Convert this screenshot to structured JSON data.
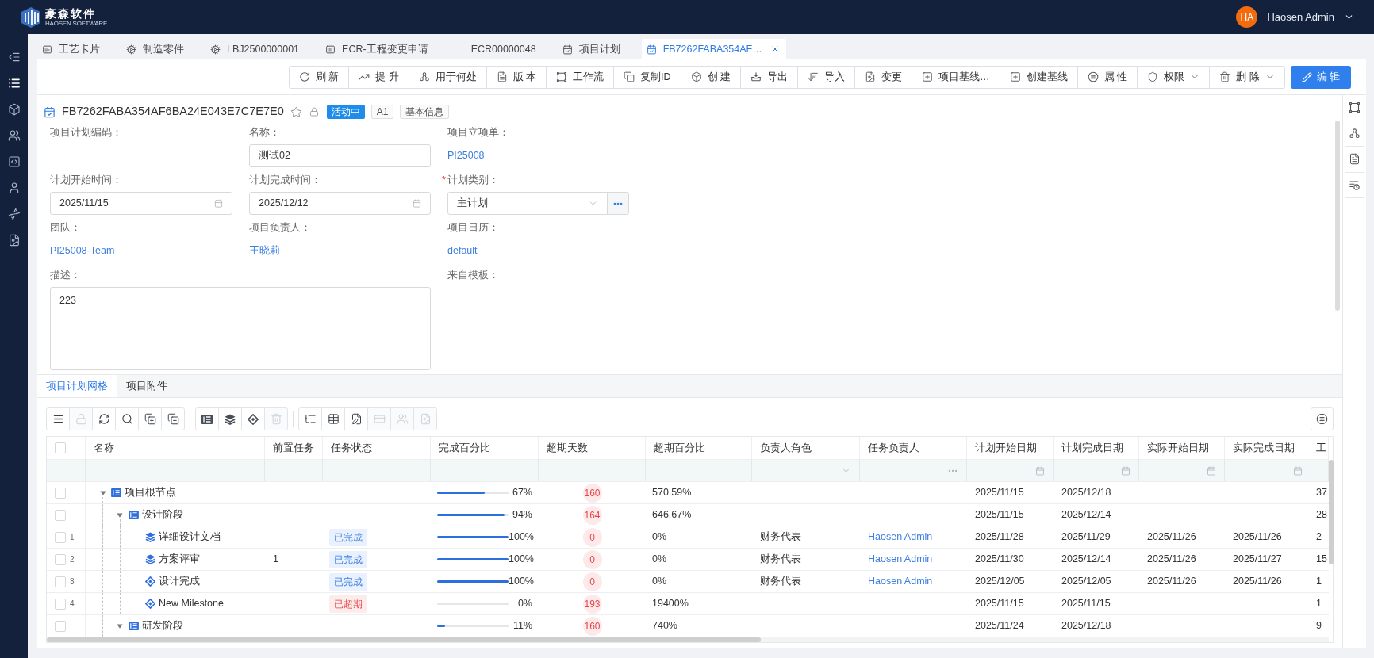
{
  "header": {
    "logo": {
      "name": "豪森软件",
      "tagline": "HAOSEN SOFTWARE"
    },
    "user": {
      "initials": "HA",
      "name": "Haosen Admin"
    }
  },
  "sidebar": {
    "items": [
      {
        "kind": "collapse",
        "selected": false
      },
      {
        "kind": "list",
        "selected": true
      },
      {
        "kind": "cube",
        "selected": false
      },
      {
        "kind": "team",
        "selected": false
      },
      {
        "kind": "code",
        "selected": false
      },
      {
        "kind": "user",
        "selected": false
      },
      {
        "kind": "dna",
        "selected": false
      },
      {
        "kind": "cad",
        "selected": false
      }
    ]
  },
  "tabs": [
    {
      "kind": "card",
      "label": "工艺卡片",
      "selected": false,
      "closable": false
    },
    {
      "kind": "part",
      "label": "制造零件",
      "selected": false,
      "closable": false
    },
    {
      "kind": "part",
      "label": "LBJ2500000001",
      "selected": false,
      "closable": false
    },
    {
      "kind": "ecr",
      "label": "ECR-工程变更申请",
      "selected": false,
      "closable": false
    },
    {
      "kind": "plain",
      "label": "ECR00000048",
      "selected": false,
      "closable": false
    },
    {
      "kind": "plan",
      "label": "项目计划",
      "selected": false,
      "closable": false
    },
    {
      "kind": "plan",
      "label": "FB7262FABA354AF…",
      "selected": true,
      "closable": true
    }
  ],
  "toolbar": {
    "buttons": [
      {
        "kind": "refresh",
        "label": "刷 新",
        "dropdown": false
      },
      {
        "kind": "promote",
        "label": "提 升",
        "dropdown": false
      },
      {
        "kind": "where_used",
        "label": "用于何处",
        "dropdown": false
      },
      {
        "kind": "version",
        "label": "版 本",
        "dropdown": false
      },
      {
        "kind": "workflow",
        "label": "工作流",
        "dropdown": false
      },
      {
        "kind": "copy",
        "label": "复制ID",
        "dropdown": false
      },
      {
        "kind": "create",
        "label": "创 建",
        "dropdown": false
      },
      {
        "kind": "export",
        "label": "导出",
        "dropdown": false
      },
      {
        "kind": "import",
        "label": "导入",
        "dropdown": false
      },
      {
        "kind": "change",
        "label": "变更",
        "dropdown": false
      },
      {
        "kind": "baseline",
        "label": "项目基线…",
        "dropdown": false
      },
      {
        "kind": "baseline",
        "label": "创建基线",
        "dropdown": false
      },
      {
        "kind": "properties",
        "label": "属 性",
        "dropdown": false
      },
      {
        "kind": "permission",
        "label": "权限",
        "dropdown": true
      },
      {
        "kind": "delete",
        "label": "删 除",
        "dropdown": true
      }
    ],
    "edit_button": {
      "label": "编 辑"
    }
  },
  "record": {
    "id": "FB7262FABA354AF6BA24E043E7C7E7E0",
    "starred": false,
    "status": "活动中",
    "revision": "A1",
    "info": "基本信息"
  },
  "form": {
    "fields": [
      {
        "kind": "text",
        "label": "项目计划编码："
      },
      {
        "kind": "input",
        "label": "名称：",
        "value": "测试02"
      },
      {
        "kind": "link",
        "label": "项目立项单：",
        "value": "PI25008"
      },
      {
        "kind": "date",
        "label": "计划开始时间：",
        "value": "2025/11/15"
      },
      {
        "kind": "date",
        "label": "计划完成时间：",
        "value": "2025/12/12"
      },
      {
        "kind": "select",
        "label": "计划类别：",
        "required_mark": "*",
        "value": "主计划"
      },
      {
        "kind": "link",
        "label": "团队：",
        "value": "PI25008-Team"
      },
      {
        "kind": "link",
        "label": "项目负责人：",
        "value": "王晓莉"
      },
      {
        "kind": "link",
        "label": "项目日历：",
        "value": "default"
      },
      {
        "kind": "textarea",
        "label": "描述：",
        "value": "223"
      },
      {
        "kind": "text",
        "label": "来自模板："
      }
    ]
  },
  "grid": {
    "tabs": [
      {
        "label": "项目计划网格",
        "selected": true
      },
      {
        "label": "项目附件",
        "selected": false
      }
    ],
    "toolbar_groups": [
      {
        "buttons": [
          {
            "kind": "menu",
            "disabled": false
          },
          {
            "kind": "lock",
            "disabled": true
          },
          {
            "kind": "reload",
            "disabled": false
          },
          {
            "kind": "search",
            "disabled": false
          },
          {
            "kind": "expand",
            "disabled": false
          },
          {
            "kind": "collapse",
            "disabled": false
          }
        ]
      },
      {
        "buttons": [
          {
            "kind": "phase",
            "disabled": false
          },
          {
            "kind": "task",
            "disabled": false
          },
          {
            "kind": "milestone",
            "disabled": false
          },
          {
            "kind": "delete",
            "disabled": true
          }
        ]
      },
      {
        "buttons": [
          {
            "kind": "tree",
            "disabled": false
          },
          {
            "kind": "table",
            "disabled": false
          },
          {
            "kind": "edit",
            "disabled": false
          },
          {
            "kind": "card",
            "disabled": true
          },
          {
            "kind": "people",
            "disabled": true
          },
          {
            "kind": "image",
            "disabled": true
          }
        ]
      }
    ],
    "table": {
      "select_all_checked": false,
      "columns": [
        {
          "label": "名称",
          "kind": "plain"
        },
        {
          "label": "前置任务",
          "kind": "plain"
        },
        {
          "label": "任务状态",
          "kind": "plain"
        },
        {
          "label": "完成百分比",
          "kind": "plain"
        },
        {
          "label": "超期天数",
          "kind": "plain"
        },
        {
          "label": "超期百分比",
          "kind": "plain"
        },
        {
          "label": "负责人角色",
          "kind": "select"
        },
        {
          "label": "任务负责人",
          "kind": "lookup"
        },
        {
          "label": "计划开始日期",
          "kind": "date"
        },
        {
          "label": "计划完成日期",
          "kind": "date"
        },
        {
          "label": "实际开始日期",
          "kind": "date"
        },
        {
          "label": "实际完成日期",
          "kind": "date"
        },
        {
          "label": "工",
          "kind": "plain"
        }
      ],
      "rows": [
        {
          "name": "项目根节点",
          "kind": "phase",
          "expanded": true,
          "checked": false,
          "progress": {
            "level": 0.67,
            "reading": "67%"
          },
          "overdue_days": "160",
          "overdue_pct": "570.59%",
          "plan_start": "2025/11/15",
          "plan_end": "2025/12/18",
          "column_13": "37",
          "children": [
            {
              "name": "设计阶段",
              "kind": "phase",
              "expanded": true,
              "checked": false,
              "progress": {
                "level": 0.94,
                "reading": "94%"
              },
              "overdue_days": "164",
              "overdue_pct": "646.67%",
              "plan_start": "2025/11/15",
              "plan_end": "2025/12/14",
              "column_13": "28",
              "children": [
                {
                  "index": "1",
                  "name": "详细设计文档",
                  "kind": "task",
                  "checked": false,
                  "status": {
                    "label": "已完成",
                    "kind": "done"
                  },
                  "progress": {
                    "level": 1,
                    "reading": "100%"
                  },
                  "overdue_days": "0",
                  "overdue_pct": "0%",
                  "role": "财务代表",
                  "owner": "Haosen Admin",
                  "plan_start": "2025/11/28",
                  "plan_end": "2025/11/29",
                  "actual_start": "2025/11/26",
                  "actual_end": "2025/11/26",
                  "column_13": "2"
                },
                {
                  "index": "2",
                  "name": "方案评审",
                  "kind": "task",
                  "checked": false,
                  "predecessor": "1",
                  "status": {
                    "label": "已完成",
                    "kind": "done"
                  },
                  "progress": {
                    "level": 1,
                    "reading": "100%"
                  },
                  "overdue_days": "0",
                  "overdue_pct": "0%",
                  "role": "财务代表",
                  "owner": "Haosen Admin",
                  "plan_start": "2025/11/30",
                  "plan_end": "2025/12/14",
                  "actual_start": "2025/11/26",
                  "actual_end": "2025/11/27",
                  "column_13": "15"
                },
                {
                  "index": "3",
                  "name": "设计完成",
                  "kind": "milestone",
                  "checked": false,
                  "status": {
                    "label": "已完成",
                    "kind": "done"
                  },
                  "progress": {
                    "level": 1,
                    "reading": "100%"
                  },
                  "overdue_days": "0",
                  "overdue_pct": "0%",
                  "role": "财务代表",
                  "owner": "Haosen Admin",
                  "plan_start": "2025/12/05",
                  "plan_end": "2025/12/05",
                  "actual_start": "2025/11/26",
                  "actual_end": "2025/11/26",
                  "column_13": "1"
                },
                {
                  "index": "4",
                  "name": "New Milestone",
                  "kind": "milestone",
                  "checked": false,
                  "status": {
                    "label": "已超期",
                    "kind": "overdue"
                  },
                  "progress": {
                    "level": 0,
                    "reading": "0%"
                  },
                  "overdue_days": "193",
                  "overdue_pct": "19400%",
                  "plan_start": "2025/11/15",
                  "plan_end": "2025/11/15",
                  "column_13": "1"
                }
              ]
            },
            {
              "name": "研发阶段",
              "kind": "phase",
              "expanded": true,
              "checked": false,
              "progress": {
                "level": 0.11,
                "reading": "11%"
              },
              "overdue_days": "160",
              "overdue_pct": "740%",
              "plan_start": "2025/11/24",
              "plan_end": "2025/12/18",
              "column_13": "9"
            }
          ]
        }
      ]
    }
  }
}
